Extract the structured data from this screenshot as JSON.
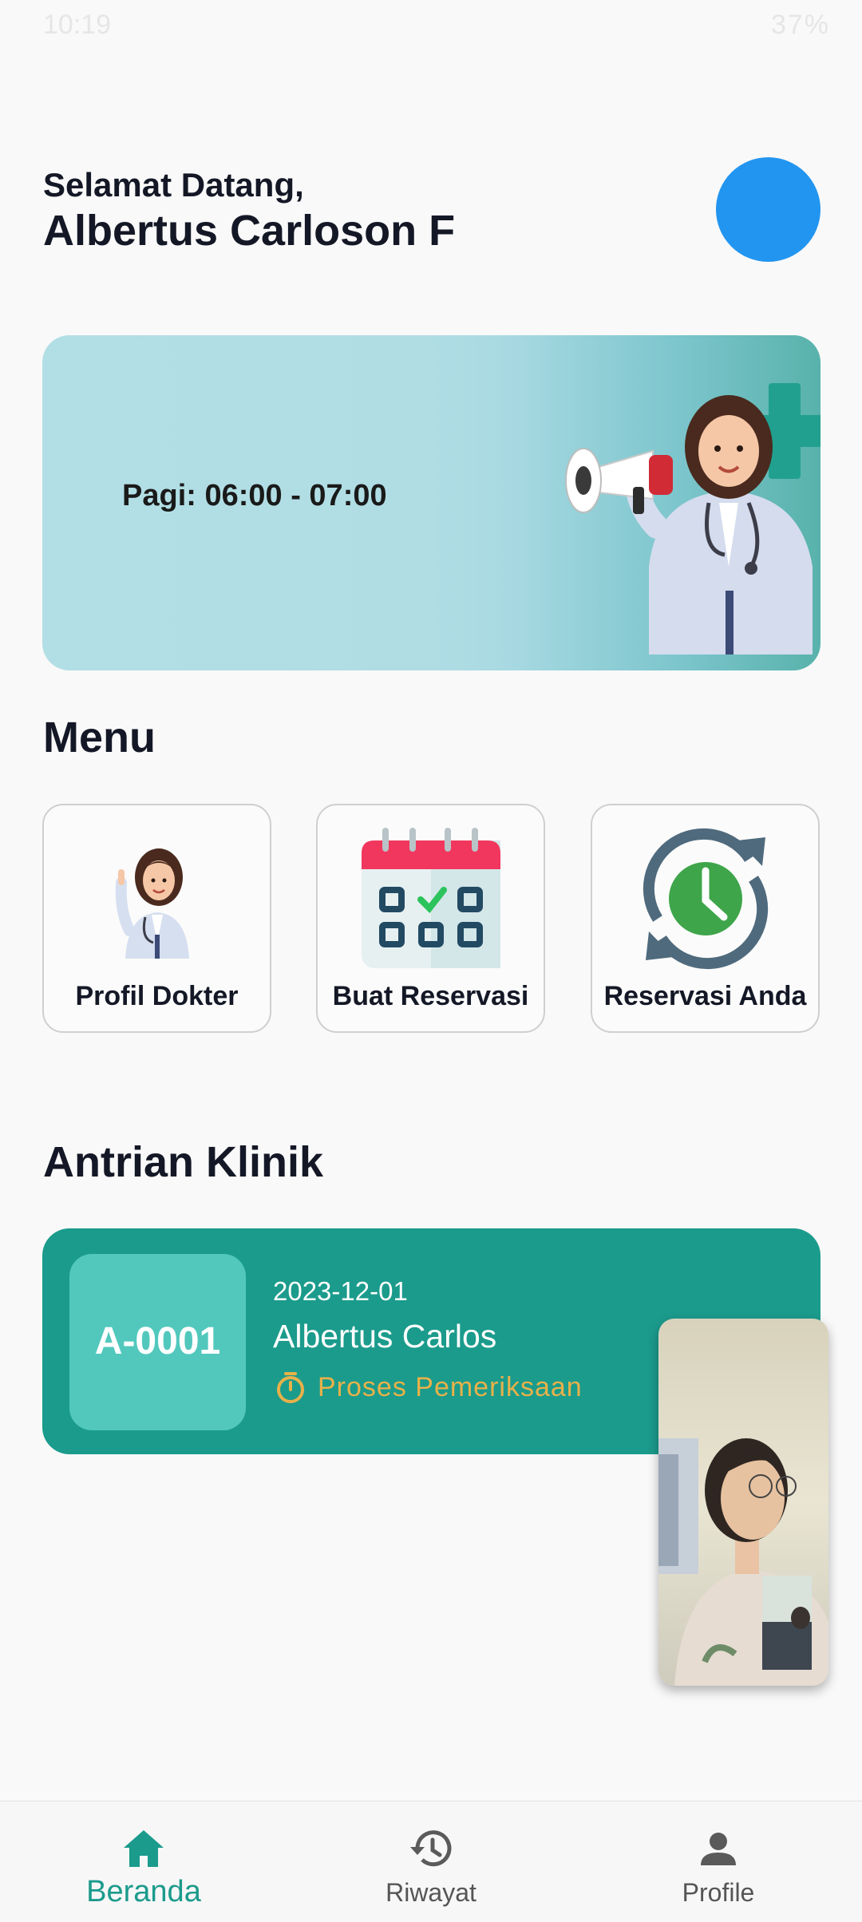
{
  "status_bar": {
    "time": "10:19",
    "battery": "37%"
  },
  "header": {
    "greeting": "Selamat Datang,",
    "user_name": "Albertus Carloson F"
  },
  "banner": {
    "schedule_text": "Pagi: 06:00 - 07:00"
  },
  "menu": {
    "title": "Menu",
    "items": [
      {
        "label": "Profil Dokter",
        "icon": "doctor-icon"
      },
      {
        "label": "Buat Reservasi",
        "icon": "calendar-icon"
      },
      {
        "label": "Reservasi Anda",
        "icon": "clock-sync-icon"
      }
    ]
  },
  "queue": {
    "title": "Antrian Klinik",
    "code": "A-0001",
    "date": "2023-12-01",
    "patient_name": "Albertus Carlos",
    "status": "Proses Pemeriksaan"
  },
  "bottom_nav": {
    "items": [
      {
        "label": "Beranda",
        "icon": "home-icon",
        "active": true
      },
      {
        "label": "Riwayat",
        "icon": "history-icon",
        "active": false
      },
      {
        "label": "Profile",
        "icon": "person-icon",
        "active": false
      }
    ]
  },
  "colors": {
    "primary": "#1b9b8c",
    "avatar": "#2295f0",
    "status": "#e8b149"
  }
}
